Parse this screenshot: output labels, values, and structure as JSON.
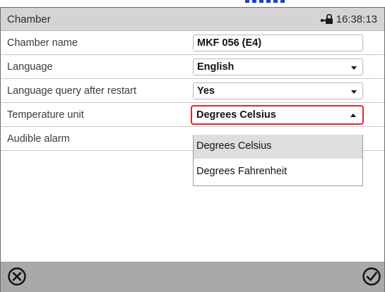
{
  "header": {
    "title": "Chamber",
    "time": "16:38:13",
    "icons": [
      "lock-icon"
    ]
  },
  "rows": {
    "chamber_name": {
      "label": "Chamber name",
      "value": "MKF 056 (E4)"
    },
    "language": {
      "label": "Language",
      "value": "English"
    },
    "language_query": {
      "label": "Language query after restart",
      "value": "Yes"
    },
    "temperature_unit": {
      "label": "Temperature unit",
      "value": "Degrees Celsius"
    },
    "audible_alarm": {
      "label": "Audible alarm"
    }
  },
  "dropdown": {
    "options": [
      "Degrees Celsius",
      "Degrees Fahrenheit"
    ],
    "selected": "Degrees Celsius"
  },
  "footer": {
    "icons": [
      "cancel-icon",
      "confirm-icon"
    ]
  },
  "colors": {
    "header_bg": "#d4d4d4",
    "footer_bg": "#a9a9a9",
    "highlight_border": "#e0262c",
    "selected_option_bg": "#dedede",
    "top_accent_text": "#1a40e0"
  }
}
